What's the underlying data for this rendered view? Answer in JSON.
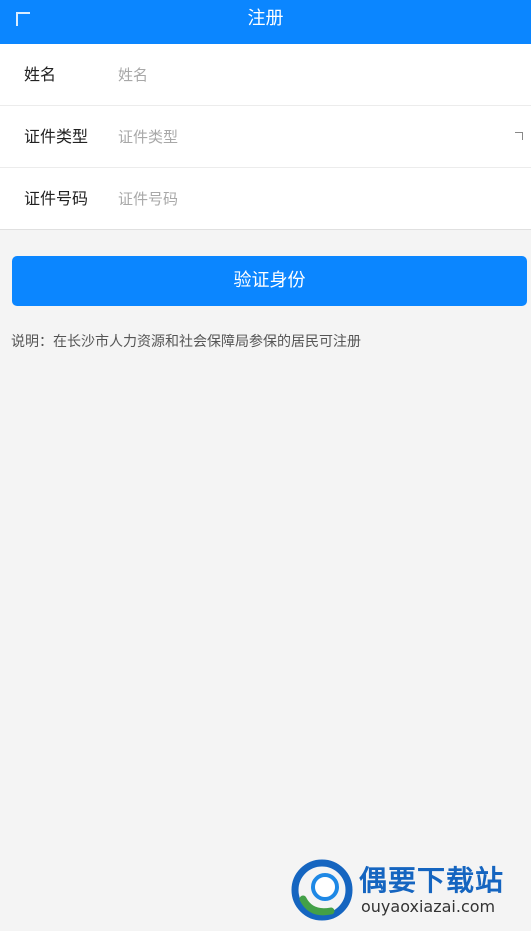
{
  "header": {
    "title": "注册",
    "back_icon": "back-corner-icon"
  },
  "form": {
    "name": {
      "label": "姓名",
      "placeholder": "姓名"
    },
    "id_type": {
      "label": "证件类型",
      "placeholder": "证件类型",
      "icon": "dropdown-corner-icon"
    },
    "id_number": {
      "label": "证件号码",
      "placeholder": "证件号码"
    }
  },
  "verify_button": {
    "label": "验证身份"
  },
  "note": "说明：在长沙市人力资源和社会保障局参保的居民可注册",
  "watermark": {
    "title": "偶要下载站",
    "url": "ouyaoxiazai.com"
  },
  "colors": {
    "primary": "#0b86ff",
    "background": "#f4f4f4",
    "placeholder": "#a8a8a8"
  }
}
